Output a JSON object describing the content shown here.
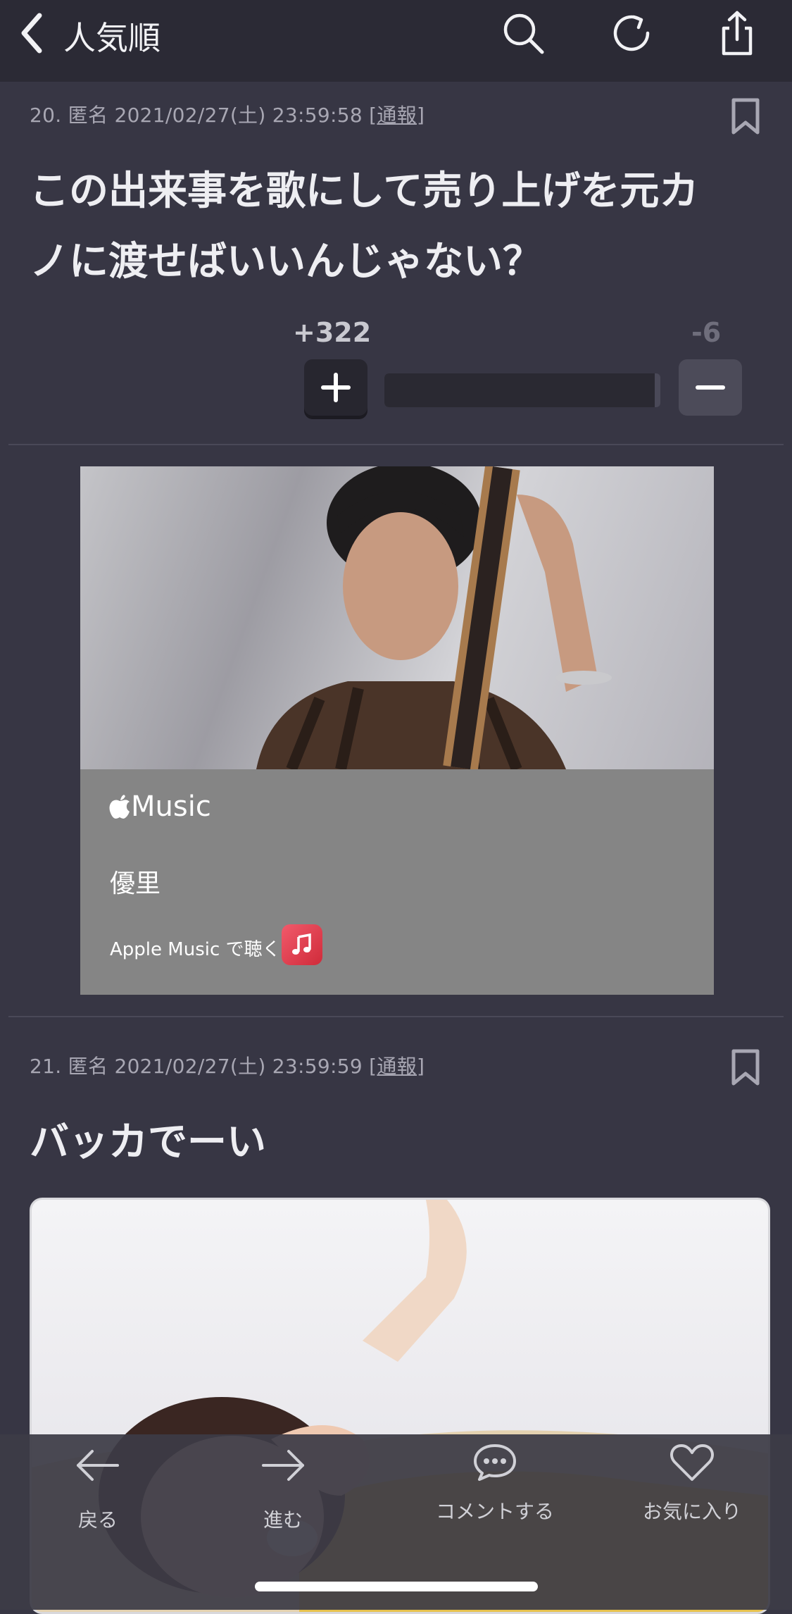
{
  "header": {
    "title": "人気順"
  },
  "comments": [
    {
      "number": "20.",
      "author": "匿名",
      "date": "2021/02/27(土) 23:59:58",
      "report_open": "[",
      "report_label": "通報",
      "report_close": "]",
      "line1": "この出来事を歌にして売り上げを元カ",
      "line2": "ノに渡せばいいんじゃない？",
      "plus_count": "+322",
      "minus_count": "-6",
      "plus_ratio": 0.98
    },
    {
      "number": "21.",
      "author": "匿名",
      "date": "2021/02/27(土) 23:59:59",
      "report_open": "[",
      "report_label": "通報",
      "report_close": "]",
      "line1": "バッカでーい"
    }
  ],
  "music_card": {
    "brand": "Music",
    "artist": "優里",
    "listen_label": "Apple Music で聴く"
  },
  "tabbar": {
    "back": "戻る",
    "forward": "進む",
    "comment": "コメントする",
    "favorite": "お気に入り"
  },
  "colors": {
    "background": "#373644",
    "topbar": "#2b2a35",
    "text_muted": "#a8a7b3",
    "plus_count": "#c9c9d0",
    "minus_count": "#6f6e7c",
    "apple_music_red": "#e23c4c"
  }
}
